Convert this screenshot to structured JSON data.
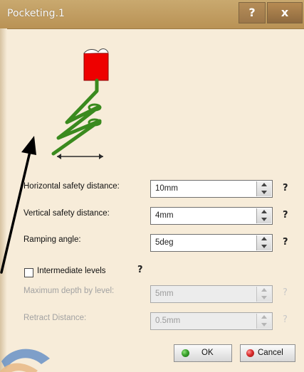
{
  "window": {
    "title": "Pocketing.1",
    "help_button": "?",
    "close_button": "x"
  },
  "fields": [
    {
      "label": "Horizontal safety distance:",
      "value": "10mm",
      "enabled": true
    },
    {
      "label": "Vertical safety distance:",
      "value": "4mm",
      "enabled": true
    },
    {
      "label": "Ramping angle:",
      "value": "5deg",
      "enabled": true
    }
  ],
  "intermediate_levels": {
    "label": "Intermediate levels",
    "checked": false,
    "help": "?"
  },
  "disabled_fields": [
    {
      "label": "Maximum depth by level:",
      "value": "5mm",
      "enabled": false
    },
    {
      "label": "Retract Distance:",
      "value": "0.5mm",
      "enabled": false
    }
  ],
  "help_marker": "?",
  "buttons": {
    "ok": "OK",
    "cancel": "Cancel"
  },
  "colors": {
    "titlebar": "#c9a96f",
    "panel": "#f7ecd9",
    "tool": "#ee0000",
    "ramp": "#3a8a1e"
  },
  "icons": {
    "ok": "green-check-icon",
    "cancel": "red-cancel-icon"
  }
}
